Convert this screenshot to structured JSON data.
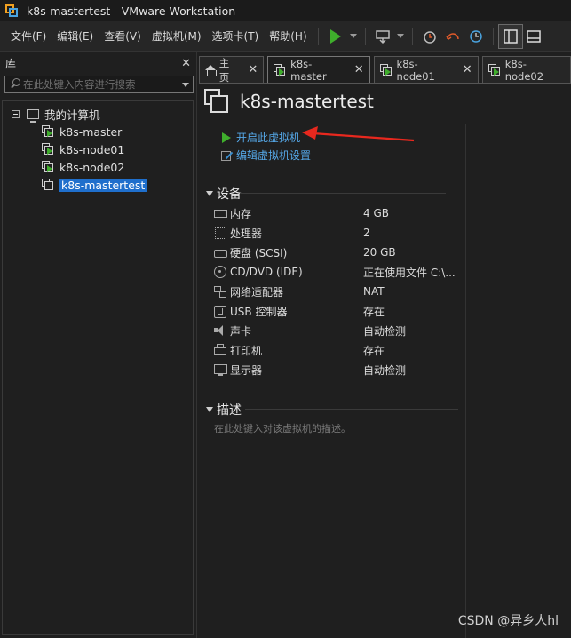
{
  "window": {
    "title": "k8s-mastertest - VMware Workstation"
  },
  "menu": [
    "文件(F)",
    "编辑(E)",
    "查看(V)",
    "虚拟机(M)",
    "选项卡(T)",
    "帮助(H)"
  ],
  "library": {
    "title": "库",
    "close": "✕",
    "search_placeholder": "在此处键入内容进行搜索",
    "root": "我的计算机",
    "items": [
      "k8s-master",
      "k8s-node01",
      "k8s-node02",
      "k8s-mastertest"
    ]
  },
  "tabs": [
    {
      "label": "主页",
      "close": "✕"
    },
    {
      "label": "k8s-master",
      "close": "✕"
    },
    {
      "label": "k8s-node01",
      "close": "✕"
    },
    {
      "label": "k8s-node02"
    }
  ],
  "vm": {
    "name": "k8s-mastertest",
    "actions": {
      "power_on": "开启此虚拟机",
      "edit_settings": "编辑虚拟机设置"
    },
    "devices_title": "设备",
    "devices": [
      {
        "name": "内存",
        "value": "4 GB",
        "icon": "memory-icon"
      },
      {
        "name": "处理器",
        "value": "2",
        "icon": "cpu-icon"
      },
      {
        "name": "硬盘 (SCSI)",
        "value": "20 GB",
        "icon": "disk-icon"
      },
      {
        "name": "CD/DVD (IDE)",
        "value": "正在使用文件 C:\\...",
        "icon": "cd-icon"
      },
      {
        "name": "网络适配器",
        "value": "NAT",
        "icon": "network-icon"
      },
      {
        "name": "USB 控制器",
        "value": "存在",
        "icon": "usb-icon"
      },
      {
        "name": "声卡",
        "value": "自动检测",
        "icon": "sound-icon"
      },
      {
        "name": "打印机",
        "value": "存在",
        "icon": "printer-icon"
      },
      {
        "name": "显示器",
        "value": "自动检测",
        "icon": "display-icon"
      }
    ],
    "description_title": "描述",
    "description_placeholder": "在此处键入对该虚拟机的描述。"
  },
  "watermark": "CSDN @异乡人hl",
  "colors": {
    "accent": "#55a8e8",
    "run_green": "#3fae2c",
    "selection": "#1f6fcc",
    "arrow_red": "#e8281e"
  }
}
